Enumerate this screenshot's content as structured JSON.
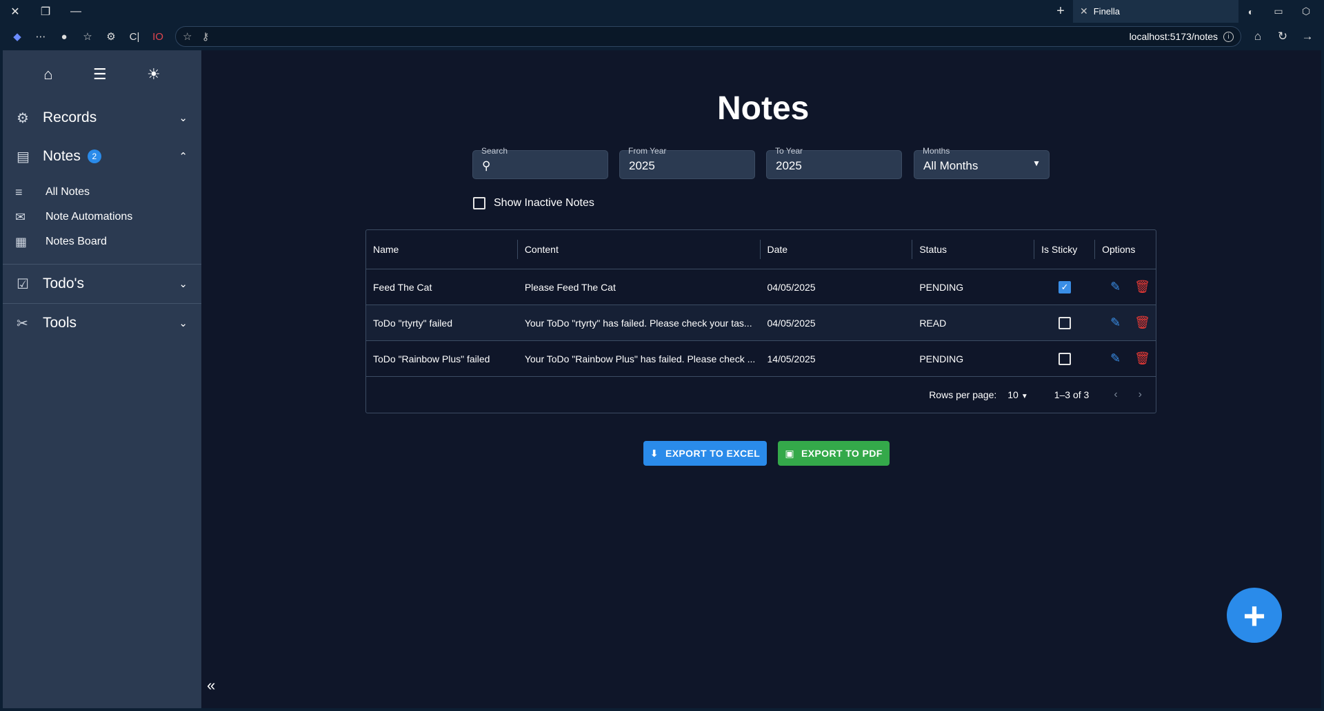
{
  "browser": {
    "tab_title": "Finella",
    "url": "localhost:5173/notes",
    "logo_text": "IO",
    "ext_text": "C|"
  },
  "sidebar": {
    "sections": {
      "records": "Records",
      "notes": "Notes",
      "notes_badge": "2",
      "todos": "Todo's",
      "tools": "Tools"
    },
    "note_items": [
      "All Notes",
      "Note Automations",
      "Notes Board"
    ]
  },
  "page": {
    "title": "Notes"
  },
  "filters": {
    "search_label": "Search",
    "search_value": "",
    "from_year_label": "From Year",
    "from_year_value": "2025",
    "to_year_label": "To Year",
    "to_year_value": "2025",
    "months_label": "Months",
    "months_value": "All Months",
    "inactive_label": "Show Inactive Notes"
  },
  "table": {
    "headers": [
      "Name",
      "Content",
      "Date",
      "Status",
      "Is Sticky",
      "Options"
    ],
    "rows": [
      {
        "name": "Feed The Cat",
        "content": "Please Feed The Cat",
        "date": "04/05/2025",
        "status": "PENDING",
        "sticky": true
      },
      {
        "name": "ToDo \"rtyrty\" failed",
        "content": "Your ToDo \"rtyrty\" has failed. Please check your tas...",
        "date": "04/05/2025",
        "status": "READ",
        "sticky": false
      },
      {
        "name": "ToDo \"Rainbow Plus\" failed",
        "content": "Your ToDo \"Rainbow Plus\" has failed. Please check ...",
        "date": "14/05/2025",
        "status": "PENDING",
        "sticky": false
      }
    ],
    "footer": {
      "rows_per_page_label": "Rows per page:",
      "rows_per_page_value": "10",
      "range": "1–3 of 3"
    }
  },
  "actions": {
    "export_excel": "EXPORT TO EXCEL",
    "export_pdf": "EXPORT TO PDF"
  },
  "colors": {
    "accent": "#2a8bea",
    "pdf_green": "#34a94a",
    "delete_red": "#e53935",
    "background": "#0f1629",
    "sidebar": "#2b3a51"
  }
}
